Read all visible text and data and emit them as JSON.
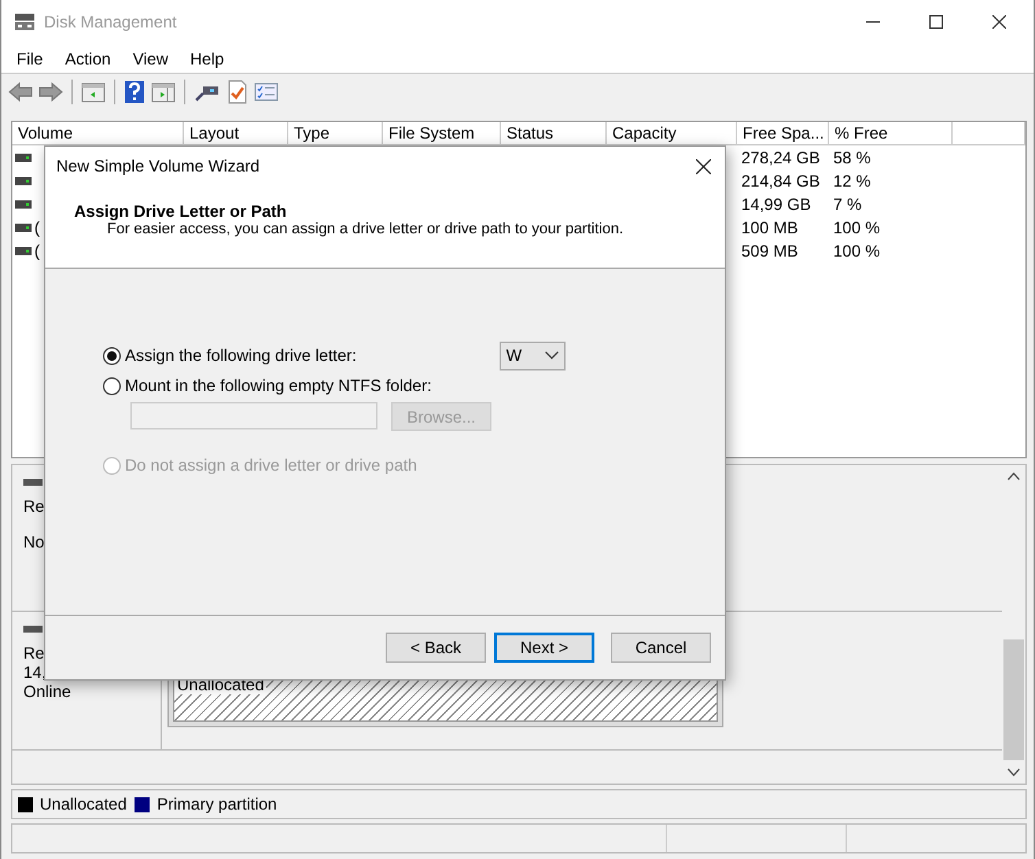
{
  "window": {
    "title": "Disk Management"
  },
  "menu": [
    "File",
    "Action",
    "View",
    "Help"
  ],
  "volume_table": {
    "columns": [
      "Volume",
      "Layout",
      "Type",
      "File System",
      "Status",
      "Capacity",
      "Free Spa...",
      "% Free"
    ],
    "rows": [
      {
        "free_space": "278,24 GB",
        "percent_free": "58 %"
      },
      {
        "free_space": "214,84 GB",
        "percent_free": "12 %"
      },
      {
        "free_space": "14,99 GB",
        "percent_free": "7 %"
      },
      {
        "volume": "(",
        "free_space": "100 MB",
        "percent_free": "100 %"
      },
      {
        "volume": "(",
        "free_space": "509 MB",
        "percent_free": "100 %"
      }
    ]
  },
  "disks": [
    {
      "lines": [
        "Re",
        "No"
      ]
    },
    {
      "lines": [
        "Re",
        "14,",
        "Online"
      ],
      "partition": "Unallocated"
    }
  ],
  "legend": [
    {
      "label": "Unallocated",
      "color": "#000000"
    },
    {
      "label": "Primary partition",
      "color": "#000080"
    }
  ],
  "dialog": {
    "title": "New Simple Volume Wizard",
    "heading": "Assign Drive Letter or Path",
    "subheading": "For easier access, you can assign a drive letter or drive path to your partition.",
    "options": [
      {
        "label": "Assign the following drive letter:",
        "selected": true,
        "disabled": false
      },
      {
        "label": "Mount in the following empty NTFS folder:",
        "selected": false,
        "disabled": false
      },
      {
        "label": "Do not assign a drive letter or drive path",
        "selected": false,
        "disabled": true
      }
    ],
    "drive_letter": {
      "value": "W"
    },
    "folder_field": {
      "disabled": true
    },
    "browse_button": {
      "label": "Browse...",
      "disabled": true
    },
    "buttons": [
      {
        "label": "< Back",
        "default": false
      },
      {
        "label": "Next >",
        "default": true
      },
      {
        "label": "Cancel",
        "default": false
      }
    ]
  }
}
